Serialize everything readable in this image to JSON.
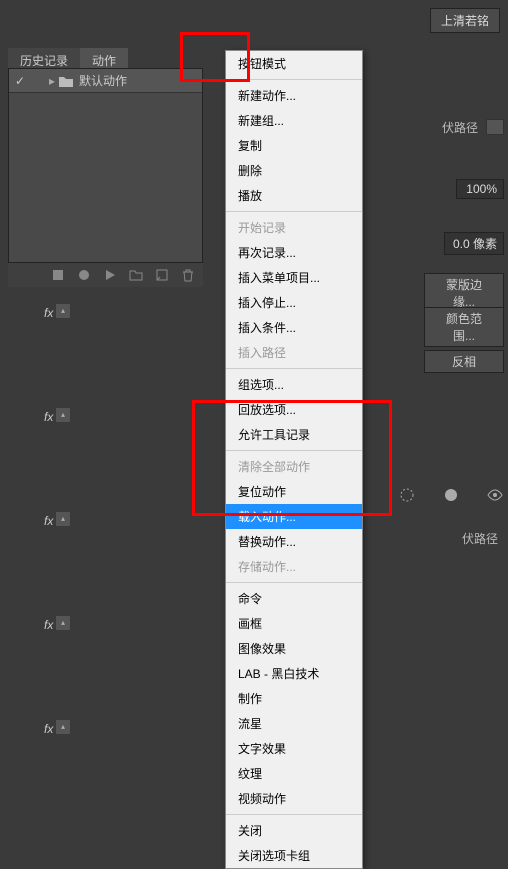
{
  "topbar": {
    "button": "上清若铭"
  },
  "tabs": {
    "history": "历史记录",
    "actions": "动作"
  },
  "actionsPanel": {
    "defaultAction": "默认动作"
  },
  "dropdown": {
    "buttonMode": "按钮模式",
    "newAction": "新建动作...",
    "newSet": "新建组...",
    "duplicate": "复制",
    "delete": "删除",
    "play": "播放",
    "startRecord": "开始记录",
    "recordAgain": "再次记录...",
    "insertMenu": "插入菜单项目...",
    "insertStop": "插入停止...",
    "insertCond": "插入条件...",
    "insertPath": "插入路径",
    "setOptions": "组选项...",
    "playbackOptions": "回放选项...",
    "allowToolRecord": "允许工具记录",
    "clearAll": "清除全部动作",
    "resetActions": "复位动作",
    "loadActions": "载入动作...",
    "replaceActions": "替换动作...",
    "saveActions": "存储动作...",
    "commands": "命令",
    "frames": "画框",
    "imageEffects": "图像效果",
    "labBw": "LAB - 黑白技术",
    "production": "制作",
    "meteor": "流星",
    "textEffects": "文字效果",
    "textures": "纹理",
    "videoActions": "视频动作",
    "close": "关闭",
    "closeTabGroup": "关闭选项卡组"
  },
  "rightPanel": {
    "pathLabel1": "伏路径",
    "percent100": "100%",
    "pixelValue": "0.0 像素",
    "maskEdge": "蒙版边缘...",
    "colorRange": "颜色范围...",
    "invert": "反相",
    "pathLabel2": "伏路径"
  }
}
